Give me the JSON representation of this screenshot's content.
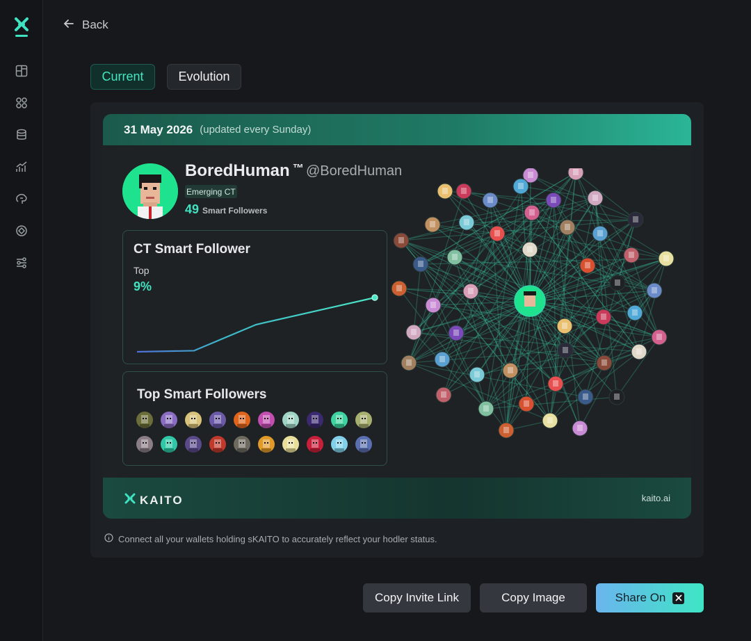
{
  "colors": {
    "accent": "#41e2bf",
    "background": "#16181c",
    "panel": "#1d2024",
    "share_gradient_start": "#6ab5ee",
    "share_gradient_end": "#3ee5c5"
  },
  "sidebar": {
    "logo_icon": "kaito-logo-icon",
    "items": [
      {
        "icon": "dashboard-icon"
      },
      {
        "icon": "network-icon"
      },
      {
        "icon": "database-icon"
      },
      {
        "icon": "chart-trend-icon"
      },
      {
        "icon": "brain-icon"
      },
      {
        "icon": "target-icon"
      },
      {
        "icon": "flow-icon"
      }
    ]
  },
  "nav": {
    "back_label": "Back"
  },
  "tabs": [
    {
      "label": "Current",
      "active": true
    },
    {
      "label": "Evolution",
      "active": false
    }
  ],
  "card": {
    "date": "31 May 2026",
    "update_note": "(updated every Sunday)",
    "profile": {
      "name": "BoredHuman",
      "tm": "™",
      "handle": "@BoredHuman",
      "badge": "Emerging CT",
      "smart_followers_count": "49",
      "smart_followers_label": "Smart Followers"
    },
    "ct_smart_follower": {
      "title": "CT Smart Follower",
      "rank_label": "Top",
      "rank_value": "9%",
      "trend": [
        0.0,
        0.02,
        0.5,
        1.0
      ]
    },
    "top_smart_followers": {
      "title": "Top Smart Followers",
      "count": 20
    },
    "footer": {
      "brand": "KAITO",
      "site": "kaito.ai"
    }
  },
  "note": "Connect all your wallets holding sKAITO to accurately reflect your hodler status.",
  "buttons": {
    "copy_invite": "Copy Invite Link",
    "copy_image": "Copy Image",
    "share_on": "Share On",
    "share_icon": "x-icon"
  }
}
